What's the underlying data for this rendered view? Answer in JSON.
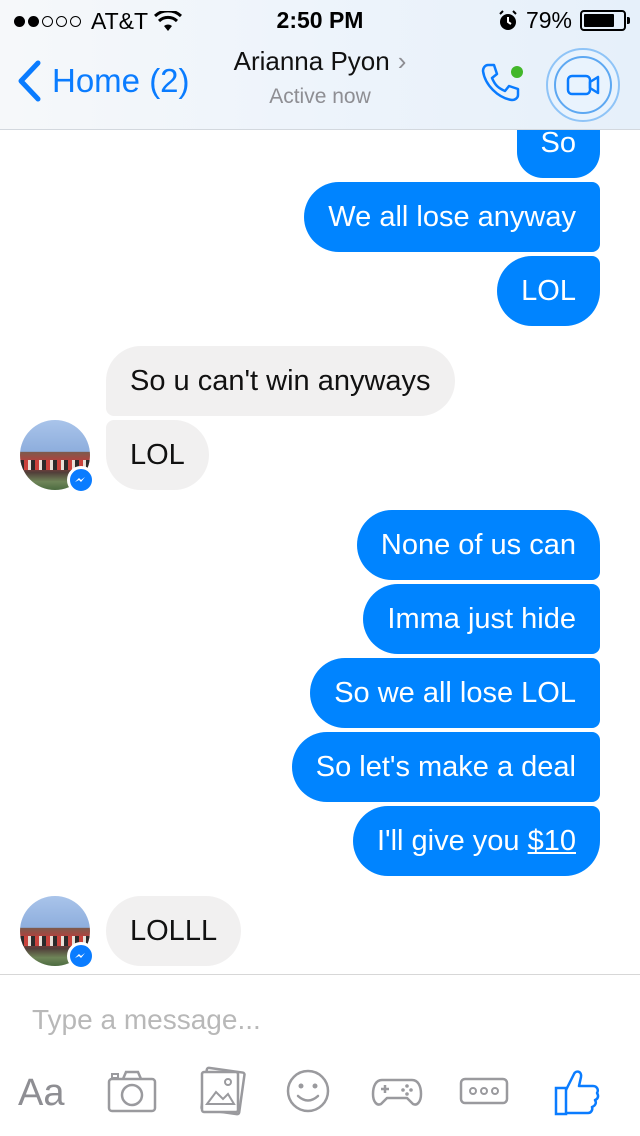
{
  "status_bar": {
    "signal_filled": 2,
    "signal_total": 5,
    "carrier": "AT&T",
    "time": "2:50 PM",
    "battery_percent": "79%",
    "battery_level": 0.79
  },
  "header": {
    "back_label": "Home (2)",
    "contact_name": "Arianna Pyon",
    "active_status": "Active now",
    "accent_color": "#0a7cff",
    "online_color": "#42b72a"
  },
  "messages": [
    {
      "direction": "out",
      "text": "So"
    },
    {
      "direction": "out",
      "text": "We all lose anyway"
    },
    {
      "direction": "out",
      "text": "LOL"
    },
    {
      "direction": "in",
      "text": "So u can't win anyways"
    },
    {
      "direction": "in",
      "text": "LOL"
    },
    {
      "direction": "out",
      "text": "None of us can"
    },
    {
      "direction": "out",
      "text": "Imma just hide"
    },
    {
      "direction": "out",
      "text": "So we all lose LOL"
    },
    {
      "direction": "out",
      "text": "So let's make a deal"
    },
    {
      "direction": "out",
      "text_before": "I'll give you ",
      "link_text": "$10"
    },
    {
      "direction": "in",
      "text": "LOLLL"
    }
  ],
  "bubble_colors": {
    "outgoing": "#0084ff",
    "incoming": "#f1f0f0"
  },
  "composer": {
    "placeholder": "Type a message...",
    "text_button_label": "Aa",
    "tools": [
      "camera-icon",
      "photo-gallery-icon",
      "emoji-icon",
      "game-controller-icon",
      "more-icon",
      "like-thumbs-up-icon"
    ]
  }
}
